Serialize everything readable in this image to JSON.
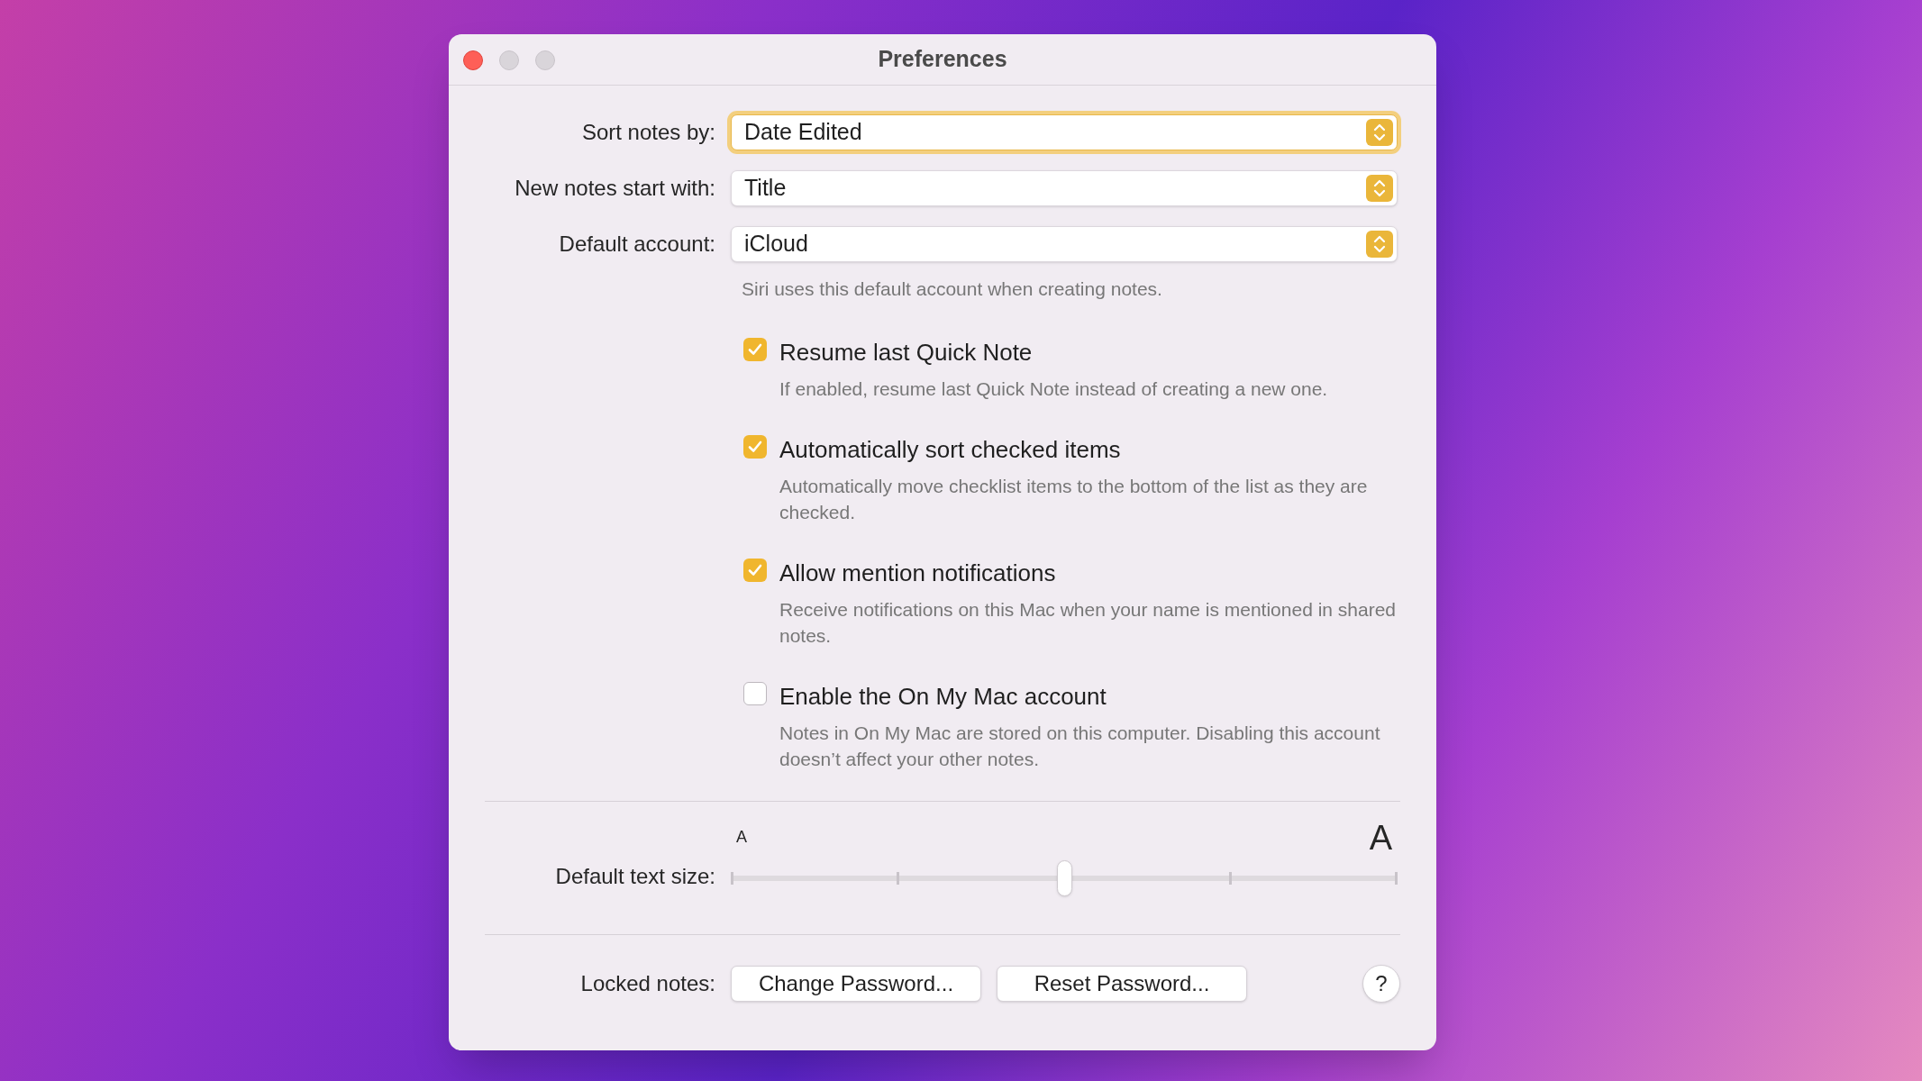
{
  "window": {
    "title": "Preferences"
  },
  "popups": [
    {
      "label": "Sort notes by:",
      "value": "Date Edited",
      "focused": true
    },
    {
      "label": "New notes start with:",
      "value": "Title",
      "focused": false
    },
    {
      "label": "Default account:",
      "value": "iCloud",
      "focused": false
    }
  ],
  "account_note": "Siri uses this default account when creating notes.",
  "checkboxes": [
    {
      "label": "Resume last Quick Note",
      "checked": true,
      "description": "If enabled, resume last Quick Note instead of creating a new one."
    },
    {
      "label": "Automatically sort checked items",
      "checked": true,
      "description": "Automatically move checklist items to the bottom of the list as they are checked."
    },
    {
      "label": "Allow mention notifications",
      "checked": true,
      "description": "Receive notifications on this Mac when your name is mentioned in shared notes."
    },
    {
      "label": "Enable the On My Mac account",
      "checked": false,
      "description": "Notes in On My Mac are stored on this computer. Disabling this account doesn’t affect your other notes."
    }
  ],
  "text_size": {
    "label": "Default text size:",
    "small_glyph": "A",
    "large_glyph": "A",
    "level": 0.5
  },
  "locked_notes": {
    "label": "Locked notes:",
    "buttons": [
      "Change Password...",
      "Reset Password..."
    ],
    "help": "?"
  }
}
